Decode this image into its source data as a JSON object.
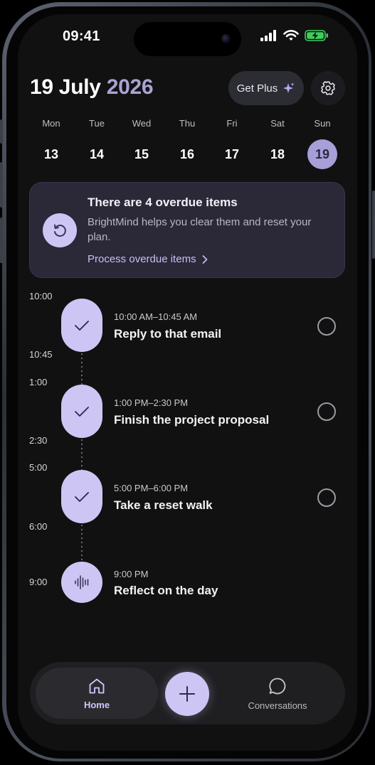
{
  "status": {
    "time": "09:41"
  },
  "header": {
    "date_main": "19 July",
    "date_year": "2026",
    "get_plus_label": "Get Plus"
  },
  "week": [
    {
      "name": "Mon",
      "num": "13"
    },
    {
      "name": "Tue",
      "num": "14"
    },
    {
      "name": "Wed",
      "num": "15"
    },
    {
      "name": "Thu",
      "num": "16"
    },
    {
      "name": "Fri",
      "num": "17"
    },
    {
      "name": "Sat",
      "num": "18"
    },
    {
      "name": "Sun",
      "num": "19",
      "selected": true
    }
  ],
  "overdue": {
    "title": "There are 4 overdue items",
    "body": "BrightMind helps you clear them and reset your plan.",
    "link": "Process overdue items"
  },
  "timeline": [
    {
      "start": "10:00",
      "end": "10:45",
      "range": "10:00 AM–10:45 AM",
      "title": "Reply to that email",
      "icon": "check-icon"
    },
    {
      "start": "1:00",
      "end": "2:30",
      "range": "1:00 PM–2:30 PM",
      "title": "Finish the project proposal",
      "icon": "check-icon"
    },
    {
      "start": "5:00",
      "end": "6:00",
      "range": "5:00 PM–6:00 PM",
      "title": "Take a reset walk",
      "icon": "check-icon"
    },
    {
      "start": "9:00",
      "range": "9:00 PM",
      "title": "Reflect on the day",
      "icon": "voice-wave-icon"
    }
  ],
  "nav": {
    "home": "Home",
    "conversations": "Conversations"
  },
  "colors": {
    "accent": "#cdc6f4",
    "background": "#111112",
    "card": "#2b2838"
  }
}
